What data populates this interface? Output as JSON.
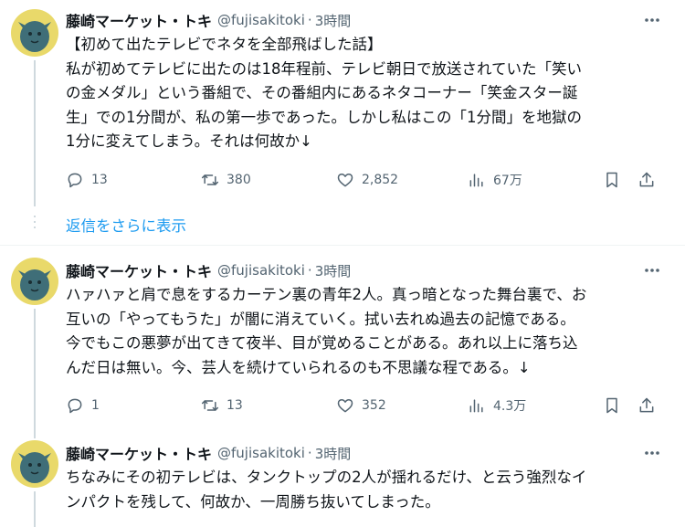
{
  "colors": {
    "text": "#0f1419",
    "secondary": "#536471",
    "link": "#1d9bf0",
    "thread_line": "#cfd9de"
  },
  "show_replies_label": "返信をさらに表示",
  "tweets": [
    {
      "author": "藤崎マーケット・トキ",
      "handle": "@fujisakitoki",
      "separator": "·",
      "time": "3時間",
      "lines": [
        "【初めて出たテレビでネタを全部飛ばした話】",
        "私が初めてテレビに出たのは18年程前、テレビ朝日で放送されていた「笑い",
        "の金メダル」という番組で、その番組内にあるネタコーナー「笑金スター誕",
        "生」での1分間が、私の第一歩であった。しかし私はこの「1分間」を地獄の",
        "1分に変えてしまう。それは何故か↓"
      ],
      "replies": "13",
      "retweets": "380",
      "likes": "2,852",
      "views": "67万"
    },
    {
      "author": "藤崎マーケット・トキ",
      "handle": "@fujisakitoki",
      "separator": "·",
      "time": "3時間",
      "lines": [
        "ハァハァと肩で息をするカーテン裏の青年2人。真っ暗となった舞台裏で、お",
        "互いの「やってもうた」が闇に消えていく。拭い去れぬ過去の記憶である。",
        "今でもこの悪夢が出てきて夜半、目が覚めることがある。あれ以上に落ち込",
        "んだ日は無い。今、芸人を続けていられるのも不思議な程である。↓"
      ],
      "replies": "1",
      "retweets": "13",
      "likes": "352",
      "views": "4.3万"
    },
    {
      "author": "藤崎マーケット・トキ",
      "handle": "@fujisakitoki",
      "separator": "·",
      "time": "3時間",
      "lines": [
        "ちなみにその初テレビは、タンクトップの2人が揺れるだけ、と云う強烈なイ",
        "ンパクトを残して、何故か、一周勝ち抜いてしまった。"
      ]
    }
  ]
}
